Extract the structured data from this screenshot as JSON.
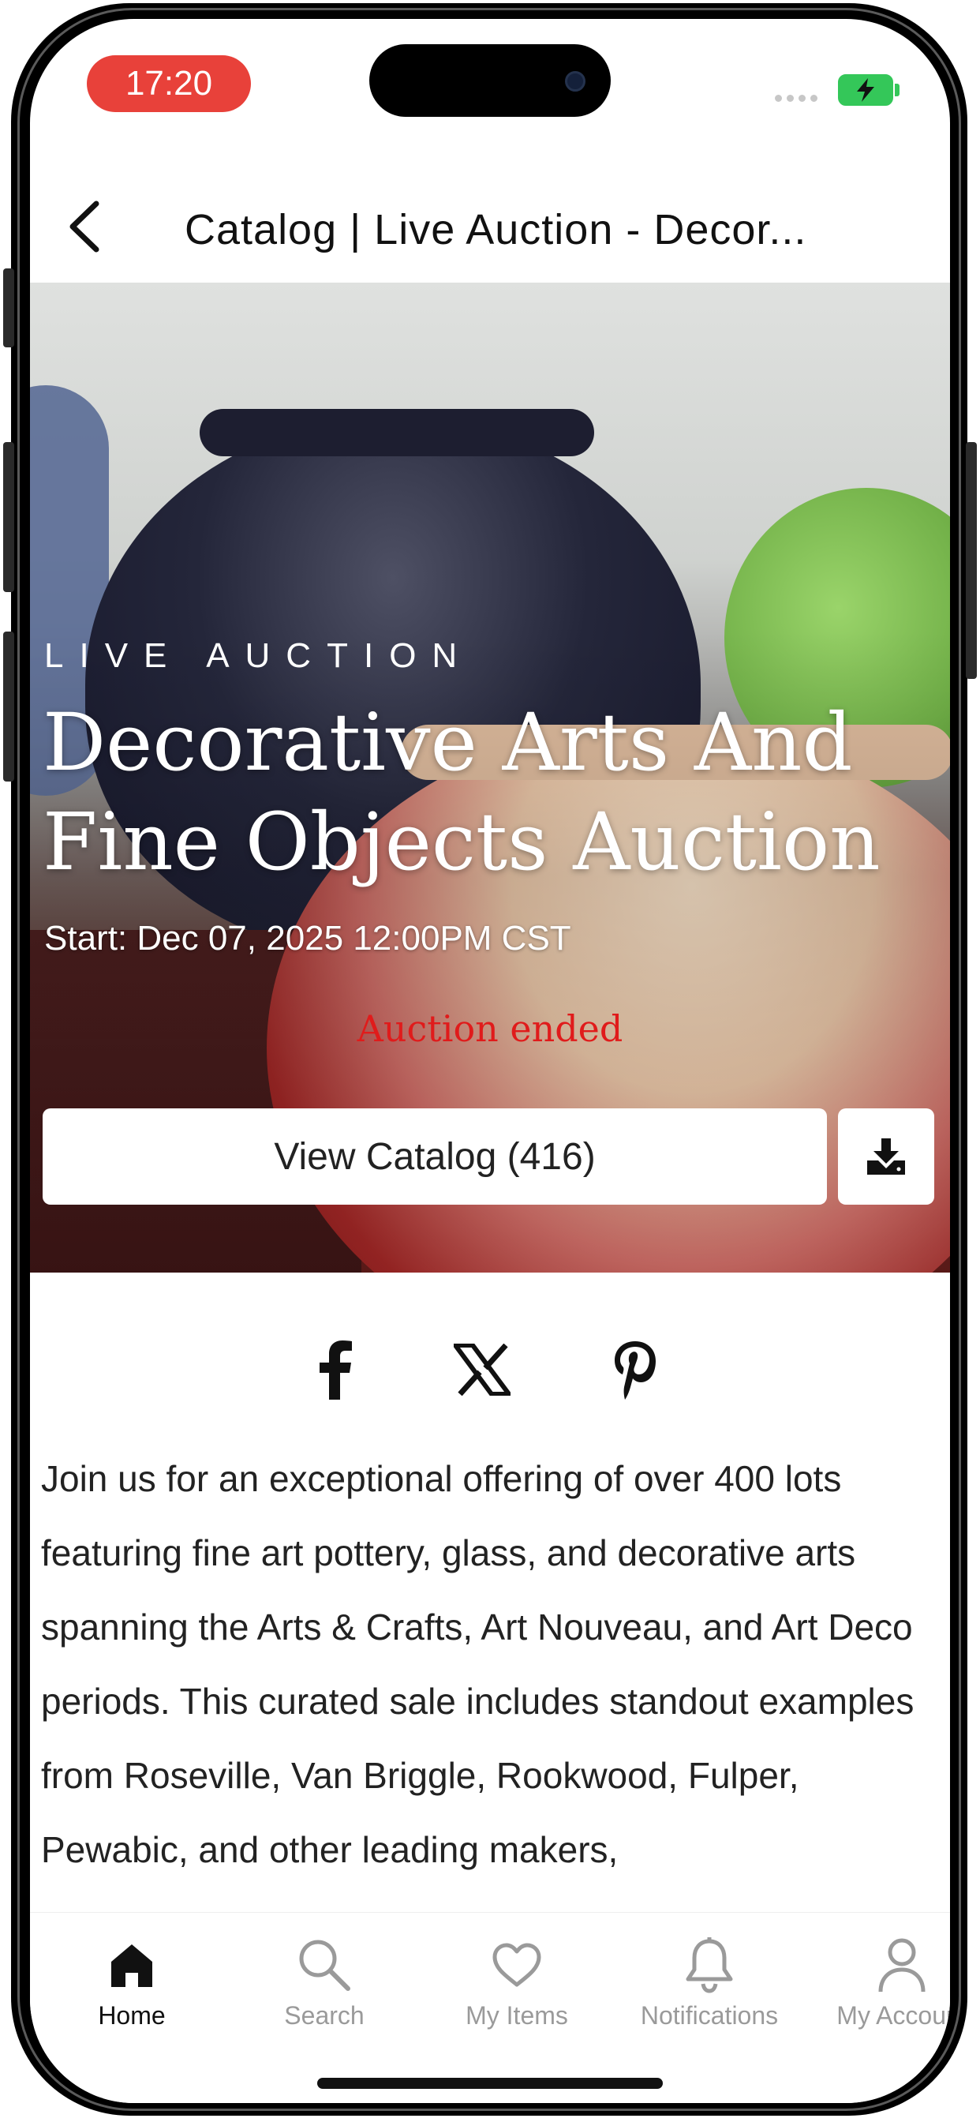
{
  "status_bar": {
    "time": "17:20"
  },
  "nav": {
    "title": "Catalog | Live Auction - Decor..."
  },
  "hero": {
    "kicker": "LIVE AUCTION",
    "title": "Decorative Arts And Fine Objects Auction",
    "start": "Start: Dec 07, 2025 12:00PM CST",
    "status": "Auction ended",
    "catalog_button": "View Catalog (416)",
    "status_color": "#e01b1b"
  },
  "social": [
    "facebook-icon",
    "x-icon",
    "pinterest-icon"
  ],
  "description": "Join us for an exceptional offering of over 400 lots featuring fine art pottery, glass, and decorative arts spanning the Arts & Crafts, Art Nouveau, and Art Deco periods. This curated sale includes standout examples from Roseville, Van Briggle, Rookwood, Fulper, Pewabic, and other leading makers,",
  "tabbar": {
    "items": [
      {
        "label": "Home",
        "icon": "home-icon",
        "active": true
      },
      {
        "label": "Search",
        "icon": "search-icon",
        "active": false
      },
      {
        "label": "My Items",
        "icon": "heart-icon",
        "active": false
      },
      {
        "label": "Notifications",
        "icon": "bell-icon",
        "active": false
      },
      {
        "label": "My Account",
        "icon": "person-icon",
        "active": false
      }
    ],
    "active_color": "#111111",
    "inactive_color": "#9a9a9a"
  }
}
